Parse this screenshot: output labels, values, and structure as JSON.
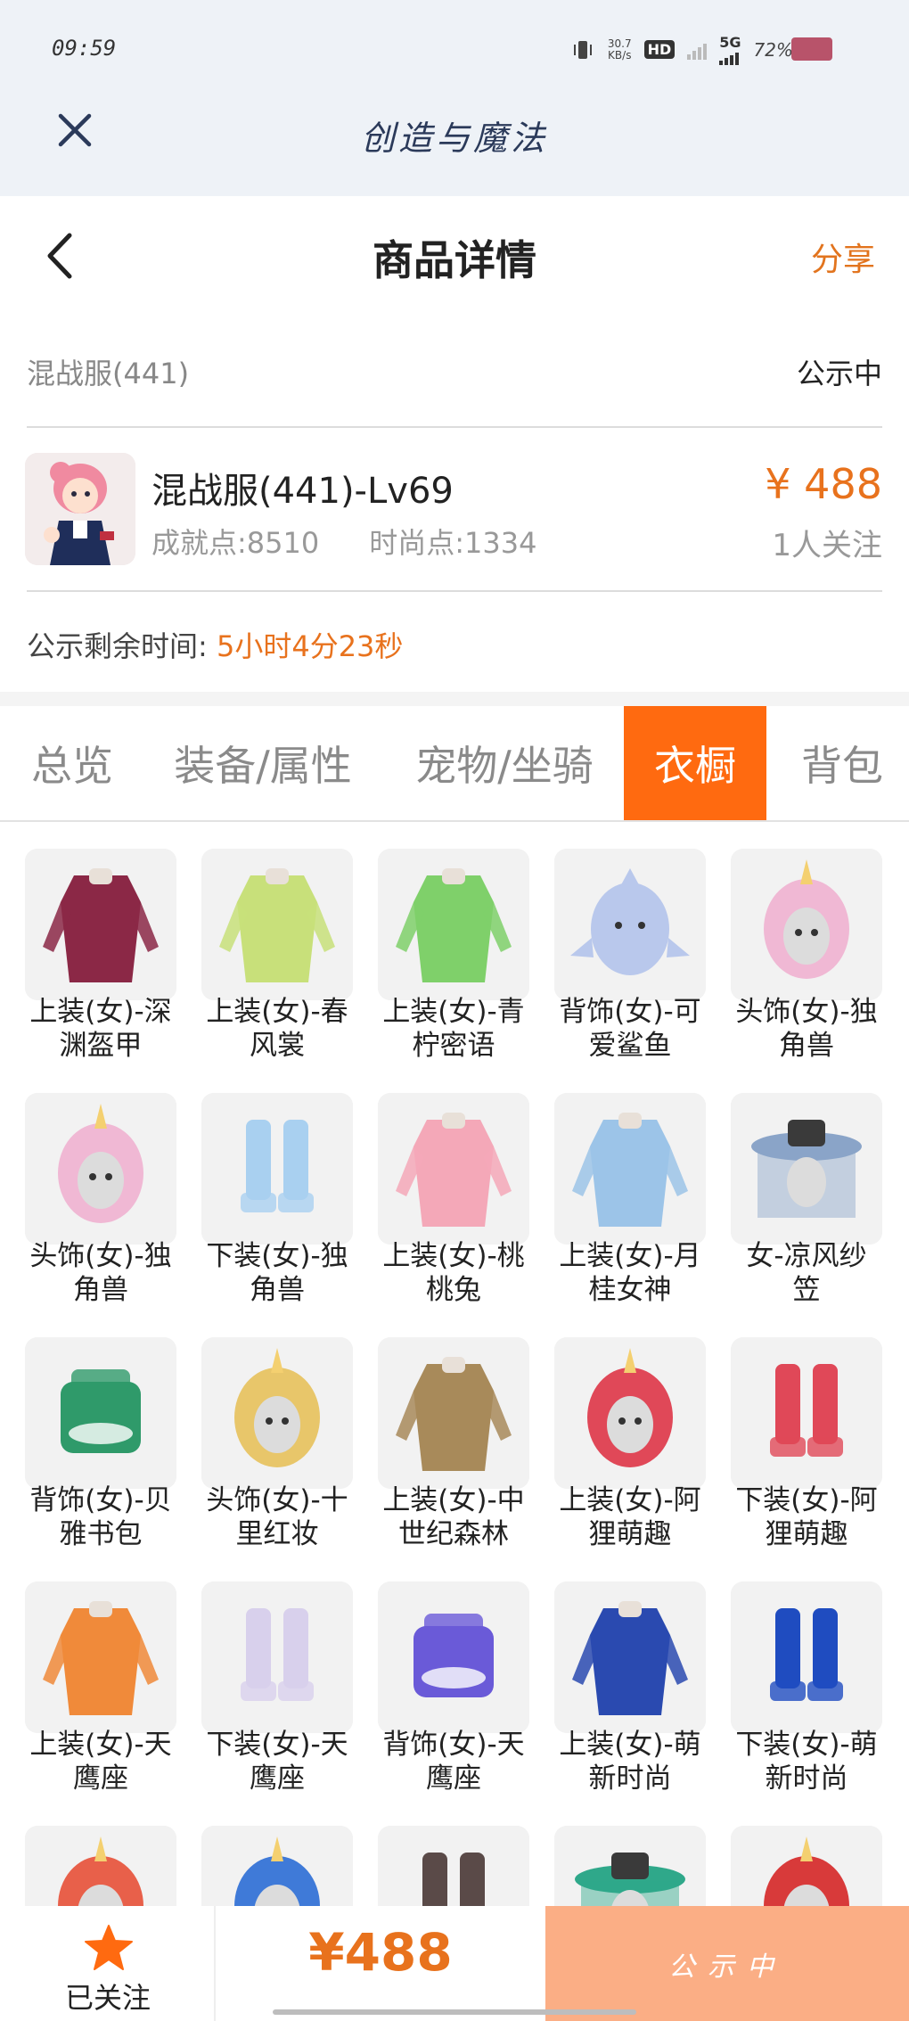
{
  "status_bar": {
    "time": "09:59",
    "net_speed_value": "30.7",
    "net_speed_unit": "KB/s",
    "hd_label": "HD",
    "network": "5G",
    "battery": "72%"
  },
  "app": {
    "title": "创造与魔法"
  },
  "header": {
    "title": "商品详情",
    "share_label": "分享"
  },
  "server": {
    "name": "混战服(441)",
    "status": "公示中"
  },
  "product": {
    "name": "混战服(441)-Lv69",
    "achievement": "成就点:8510",
    "fashion": "时尚点:1334",
    "price": "¥ 488",
    "followers": "1人关注"
  },
  "remaining": {
    "label": "公示剩余时间:",
    "value": "5小时4分23秒"
  },
  "tabs": [
    {
      "label": "总览",
      "active": false
    },
    {
      "label": "装备/属性",
      "active": false
    },
    {
      "label": "宠物/坐骑",
      "active": false
    },
    {
      "label": "衣橱",
      "active": true
    },
    {
      "label": "背包",
      "active": false
    }
  ],
  "wardrobe_items": [
    {
      "line1": "上装(女)-深",
      "line2": "渊盔甲",
      "icon": "dark-armor-outfit",
      "color": "#8b2846"
    },
    {
      "line1": "上装(女)-春",
      "line2": "风裳",
      "icon": "spring-dress-outfit",
      "color": "#c8e07a"
    },
    {
      "line1": "上装(女)-青",
      "line2": "柠密语",
      "icon": "green-gown-outfit",
      "color": "#7fd06a"
    },
    {
      "line1": "背饰(女)-可",
      "line2": "爱鲨鱼",
      "icon": "shark-backpack",
      "color": "#b9c8ec"
    },
    {
      "line1": "头饰(女)-独",
      "line2": "角兽",
      "icon": "unicorn-hood",
      "color": "#f0b8d4"
    },
    {
      "line1": "头饰(女)-独",
      "line2": "角兽",
      "icon": "unicorn-hood",
      "color": "#f0b8d4"
    },
    {
      "line1": "下装(女)-独",
      "line2": "角兽",
      "icon": "unicorn-boots",
      "color": "#a9d0f0"
    },
    {
      "line1": "上装(女)-桃",
      "line2": "桃兔",
      "icon": "peach-bunny-outfit",
      "color": "#f4a8b8"
    },
    {
      "line1": "上装(女)-月",
      "line2": "桂女神",
      "icon": "laurel-goddess-outfit",
      "color": "#9cc4e8"
    },
    {
      "line1": "女-凉风纱",
      "line2": "笠",
      "icon": "veil-hat",
      "color": "#8aa4c8"
    },
    {
      "line1": "背饰(女)-贝",
      "line2": "雅书包",
      "icon": "school-bag",
      "color": "#2f9a6a"
    },
    {
      "line1": "头饰(女)-十",
      "line2": "里红妆",
      "icon": "golden-headdress",
      "color": "#e8c66a"
    },
    {
      "line1": "上装(女)-中",
      "line2": "世纪森林",
      "icon": "forest-dress",
      "color": "#a88a5a"
    },
    {
      "line1": "上装(女)-阿",
      "line2": "狸萌趣",
      "icon": "fox-hoodie",
      "color": "#e04858"
    },
    {
      "line1": "下装(女)-阿",
      "line2": "狸萌趣",
      "icon": "fox-boots",
      "color": "#e04858"
    },
    {
      "line1": "上装(女)-天",
      "line2": "鹰座",
      "icon": "aquila-jacket",
      "color": "#f08a3a"
    },
    {
      "line1": "下装(女)-天",
      "line2": "鹰座",
      "icon": "aquila-boots",
      "color": "#d8d0ec"
    },
    {
      "line1": "背饰(女)-天",
      "line2": "鹰座",
      "icon": "aquila-backpack",
      "color": "#6a5ad8"
    },
    {
      "line1": "上装(女)-萌",
      "line2": "新时尚",
      "icon": "blue-corset",
      "color": "#2a4ab0"
    },
    {
      "line1": "下装(女)-萌",
      "line2": "新时尚",
      "icon": "blue-skirt",
      "color": "#1f4cc0"
    },
    {
      "line1": "",
      "line2": "",
      "icon": "horned-hair",
      "color": "#e8604a"
    },
    {
      "line1": "",
      "line2": "",
      "icon": "blue-octopus-hat",
      "color": "#3f7ad8"
    },
    {
      "line1": "",
      "line2": "",
      "icon": "dark-boots",
      "color": "#5a4a48"
    },
    {
      "line1": "",
      "line2": "",
      "icon": "leaf-hat",
      "color": "#2fa88a"
    },
    {
      "line1": "",
      "line2": "",
      "icon": "red-cat-hood",
      "color": "#d83a3a"
    }
  ],
  "bottom_bar": {
    "follow_label": "已关注",
    "price": "¥488",
    "status_button": "公示中"
  },
  "colors": {
    "accent": "#ff6a10",
    "price": "#e8721d",
    "status_button_bg": "#fbae85"
  }
}
